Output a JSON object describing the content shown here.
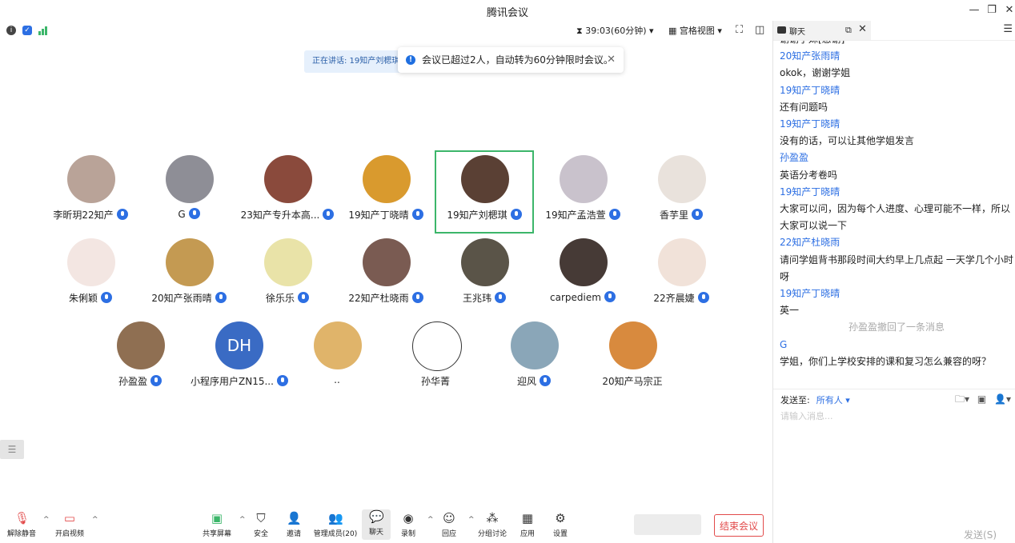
{
  "window": {
    "title": "腾讯会议"
  },
  "toolbar": {
    "timer": "39:03(60分钟)",
    "view_mode": "宫格视图"
  },
  "speaking_label": "正在讲话: 19知产刘楒琪",
  "toast": {
    "message": "会议已超过2人，自动转为60分钟限时会议。"
  },
  "participants": [
    {
      "name": "李昕玥22知产",
      "color": "#b9a398"
    },
    {
      "name": "G",
      "color": "#8e8e96"
    },
    {
      "name": "23知产专升本高...",
      "color": "#8a4a3c"
    },
    {
      "name": "19知产丁晓晴",
      "color": "#d99a2e"
    },
    {
      "name": "19知产刘楒琪",
      "color": "#5a4034"
    },
    {
      "name": "19知产孟浩萱",
      "color": "#c9c2cc"
    },
    {
      "name": "香芋里",
      "color": "#e9e2dc"
    },
    {
      "name": "朱俐颖",
      "color": "#f3e6e2"
    },
    {
      "name": "20知产张雨晴",
      "color": "#c49a52"
    },
    {
      "name": "徐乐乐",
      "color": "#e9e3a8"
    },
    {
      "name": "22知产杜晓雨",
      "color": "#7a5b52"
    },
    {
      "name": "王兆玮",
      "color": "#5a5448"
    },
    {
      "name": "carpediem",
      "color": "#463a36"
    },
    {
      "name": "22齐晨婕",
      "color": "#f1e2d9"
    },
    {
      "name": "孙盈盈",
      "color": "#8f6f52"
    },
    {
      "name": "小程序用户ZN15...",
      "color": "#3a6bc4",
      "initials": "DH"
    },
    {
      "name": "..",
      "color": "#e0b46a"
    },
    {
      "name": "孙华菁",
      "color": "#ffffff"
    },
    {
      "name": "迎风",
      "color": "#8aa6b8"
    },
    {
      "name": "20知产马宗正",
      "color": "#d88a3e"
    }
  ],
  "bottom": {
    "unmute": "解除静音",
    "video": "开启视频",
    "share": "共享屏幕",
    "security": "安全",
    "invite": "邀请",
    "members": "管理成员(20)",
    "chat": "聊天",
    "record": "录制",
    "react": "回应",
    "breakout": "分组讨论",
    "apps": "应用",
    "settings": "设置",
    "end": "结束会议"
  },
  "chat": {
    "tab": "聊天",
    "messages": [
      {
        "kind": "text",
        "v": "谢谢学妹[感谢]"
      },
      {
        "kind": "sender",
        "v": "20知产张雨晴"
      },
      {
        "kind": "text",
        "v": "okok，谢谢学姐"
      },
      {
        "kind": "sender",
        "v": "19知产丁晓晴"
      },
      {
        "kind": "text",
        "v": "还有问题吗"
      },
      {
        "kind": "sender",
        "v": "19知产丁晓晴"
      },
      {
        "kind": "text",
        "v": "没有的话，可以让其他学姐发言"
      },
      {
        "kind": "sender",
        "v": "孙盈盈"
      },
      {
        "kind": "text",
        "v": "英语分考卷吗"
      },
      {
        "kind": "sender",
        "v": "19知产丁晓晴"
      },
      {
        "kind": "text",
        "v": "大家可以问，因为每个人进度、心理可能不一样，所以"
      },
      {
        "kind": "text",
        "v": "大家可以说一下"
      },
      {
        "kind": "sender",
        "v": "22知产杜晓雨"
      },
      {
        "kind": "text",
        "v": "请问学姐背书那段时间大约早上几点起 一天学几个小时"
      },
      {
        "kind": "text",
        "v": "呀"
      },
      {
        "kind": "sender",
        "v": "19知产丁晓晴"
      },
      {
        "kind": "text",
        "v": "英一"
      },
      {
        "kind": "sys",
        "v": "孙盈盈撤回了一条消息"
      },
      {
        "kind": "sender",
        "v": "G"
      },
      {
        "kind": "text",
        "v": "学姐，你们上学校安排的课和复习怎么兼容的呀？"
      }
    ],
    "send_to_label": "发送至:",
    "send_to_value": "所有人 ▾",
    "input_placeholder": "请输入消息...",
    "send_button": "发送(S)"
  }
}
